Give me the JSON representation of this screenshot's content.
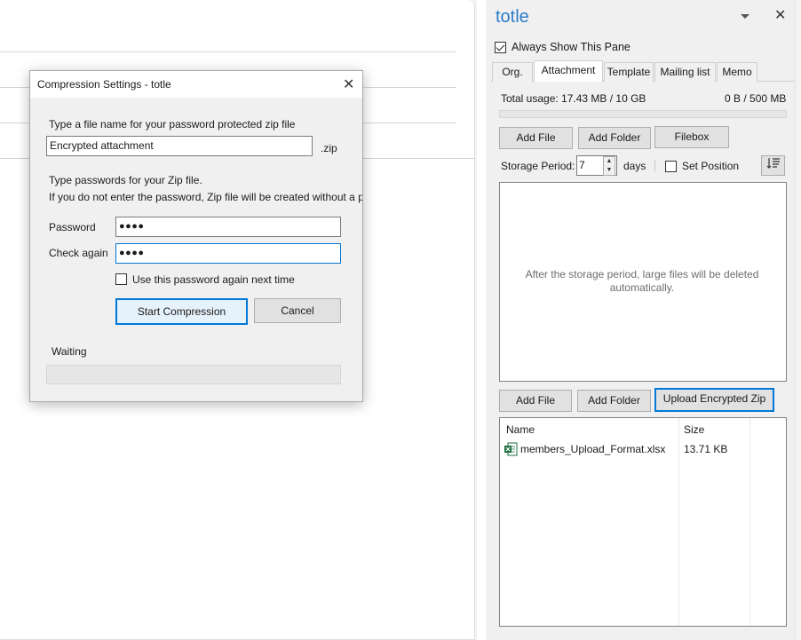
{
  "pane": {
    "title": "totle",
    "always_show_label": "Always Show This Pane",
    "always_show_checked": true,
    "tabs": [
      "Org.",
      "Attachment",
      "Template",
      "Mailing list",
      "Memo"
    ],
    "active_tab": "Attachment",
    "total_usage": "Total usage: 17.43 MB / 10 GB",
    "usage_right": "0 B / 500 MB",
    "buttons_top": {
      "add_file": "Add File",
      "add_folder": "Add Folder",
      "filebox": "Filebox"
    },
    "storage_period_label": "Storage Period:",
    "storage_period_value": "7",
    "days_label": "days",
    "set_position_label": "Set Position",
    "set_position_checked": false,
    "drop_message": "After the storage period, large files will be deleted automatically.",
    "buttons_bottom": {
      "add_file": "Add File",
      "add_folder": "Add Folder",
      "upload_zip": "Upload Encrypted Zip"
    },
    "file_list": {
      "columns": [
        "Name",
        "Size"
      ],
      "rows": [
        {
          "name": "members_Upload_Format.xlsx",
          "size": "13.71 KB"
        }
      ]
    }
  },
  "dialog": {
    "title": "Compression Settings - totle",
    "filename_prompt": "Type a file name for your password protected zip file",
    "filename_value": "Encrypted attachment",
    "extension": ".zip",
    "password_prompt_1": "Type passwords for your Zip file.",
    "password_prompt_2": "If you do not enter the password, Zip file will be created without a p",
    "password_label": "Password",
    "password_value": "●●●●",
    "check_label": "Check again",
    "check_value": "●●●●",
    "remember_label": "Use this password again next time",
    "remember_checked": false,
    "start_button": "Start Compression",
    "cancel_button": "Cancel",
    "status": "Waiting",
    "progress": 0
  },
  "colors": {
    "accent": "#0078d7",
    "title_blue": "#2b7bc8",
    "excel_green": "#1d6f42"
  },
  "icons": [
    "dropdown-arrow-icon",
    "close-icon",
    "checkbox-checked-icon",
    "sort-icon",
    "excel-file-icon",
    "spin-up-icon",
    "spin-down-icon"
  ]
}
